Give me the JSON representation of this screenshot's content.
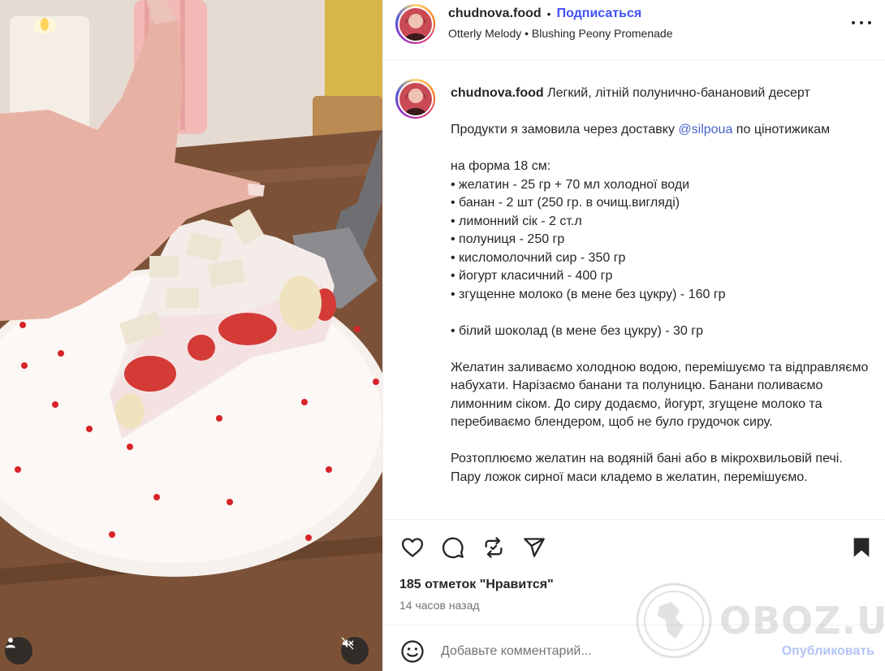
{
  "post": {
    "username": "chudnova.food",
    "follow_label": "Подписаться",
    "audio": "Otterly Melody • Blushing Peony Promenade",
    "caption_user": "chudnova.food",
    "caption_title": " Легкий, літній полунично-банановий десерт",
    "caption_intro": "\n\nПродукти я замовила через доставку ",
    "mention": "@silpoua",
    "caption_body": " по цінотижикам\n\nна форма 18 см:\n• желатин - 25 гр + 70 мл холодної води\n• банан - 2 шт (250 гр. в очищ.вигляді)\n• лимонний сік - 2 ст.л\n• полуниця - 250 гр\n• кисломолочний сир - 350 гр\n• йогурт класичний - 400 гр\n• згущенне молоко (в мене без цукру) - 160 гр\n\n• білий шоколад (в мене без цукру) - 30 гр\n\nЖелатин заливаємо холодною водою, перемішуємо та відправляємо набухати. Нарізаємо банани та полуницю. Банани поливаємо лимонним сіком. До сиру додаємо, йогурт, згущене молоко та перебиваємо блендером, щоб не було грудочок сиру.\n\nРозтоплюємо желатин на водяній бані або в мікрохвильовій печі.\nПару ложок сирної маси кладемо в желатин, перемішуємо.",
    "likes": "185 отметок \"Нравится\"",
    "time_ago": "14 часов назад"
  },
  "comment": {
    "placeholder": "Добавьте комментарий...",
    "publish_label": "Опубликовать"
  },
  "watermark": "OBOZ.UA",
  "icons": {
    "like": "heart-icon",
    "comment": "comment-icon",
    "repost": "repost-icon",
    "share": "share-icon",
    "save": "bookmark-icon",
    "more": "more-icon",
    "emoji": "emoji-icon",
    "tagged_user": "user-icon",
    "mute": "muted-speaker-icon"
  },
  "colors": {
    "follow": "#4150f7",
    "mention": "#4663c8",
    "publish_disabled": "#b2c4f5",
    "heart_dots": "#d8232a"
  }
}
